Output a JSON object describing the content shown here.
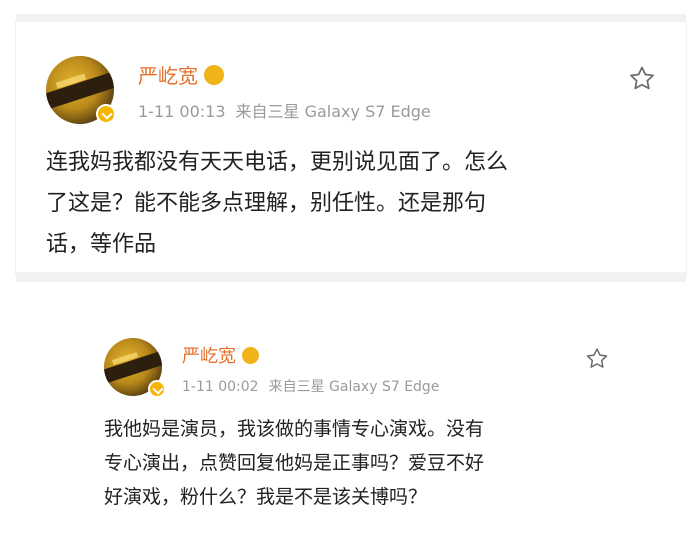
{
  "posts": [
    {
      "username": "严屹宽",
      "time": "1-11 00:13",
      "source": "来自三星 Galaxy S7 Edge",
      "body_lines": [
        "连我妈我都没有天天电话，更别说见面了。怎么",
        "了这是？能不能多点理解，别任性。还是那句",
        "话，等作品"
      ]
    },
    {
      "username": "严屹宽",
      "time": "1-11 00:02",
      "source": "来自三星 Galaxy S7 Edge",
      "body_lines": [
        "我他妈是演员，我该做的事情专心演戏。没有",
        "专心演出，点赞回复他妈是正事吗？爱豆不好",
        "好演戏，粉什么？我是不是该关博吗？"
      ]
    }
  ],
  "colors": {
    "username": "#e5702a",
    "meta": "#9a9a9a",
    "body": "#222222",
    "badge": "#f4b400"
  },
  "icons": {
    "favorite": "star-outline-icon",
    "verified": "verified-badge-icon",
    "vip": "vip-crown-icon"
  }
}
